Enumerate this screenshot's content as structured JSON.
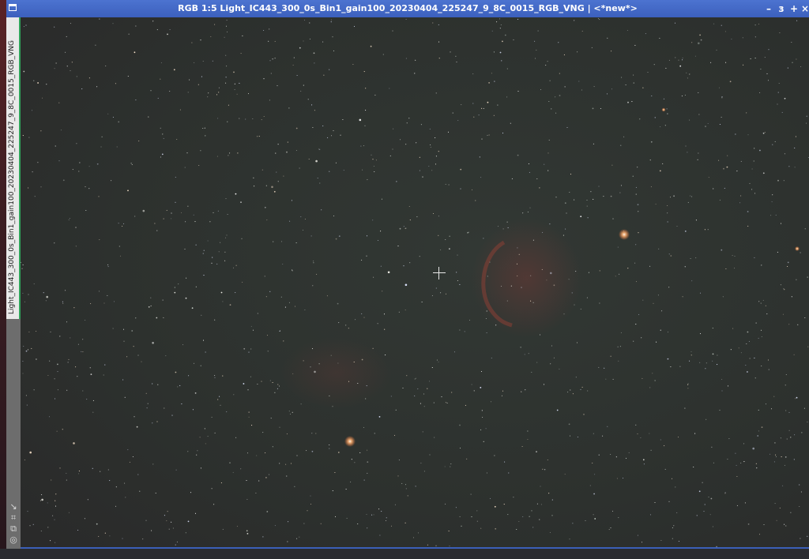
{
  "window": {
    "title": "RGB 1:5 Light_IC443_300_0s_Bin1_gain100_20230404_225247_9_8C_0015_RGB_VNG | <*new*>",
    "controls": {
      "minimize": "–",
      "maximize": "з",
      "expand": "+",
      "close": "×"
    },
    "tab_label": "Light_IC443_300_0s_Bin1_gain100_20230404_225247_9_8C_0015_RGB_VNG"
  },
  "side_tools": [
    "arrow-icon",
    "stretch-icon",
    "clone-icon",
    "settings-icon"
  ],
  "colors": {
    "frame": "#3b5fb8",
    "sky": "#2c302d",
    "nebula": "#7a3a33"
  }
}
